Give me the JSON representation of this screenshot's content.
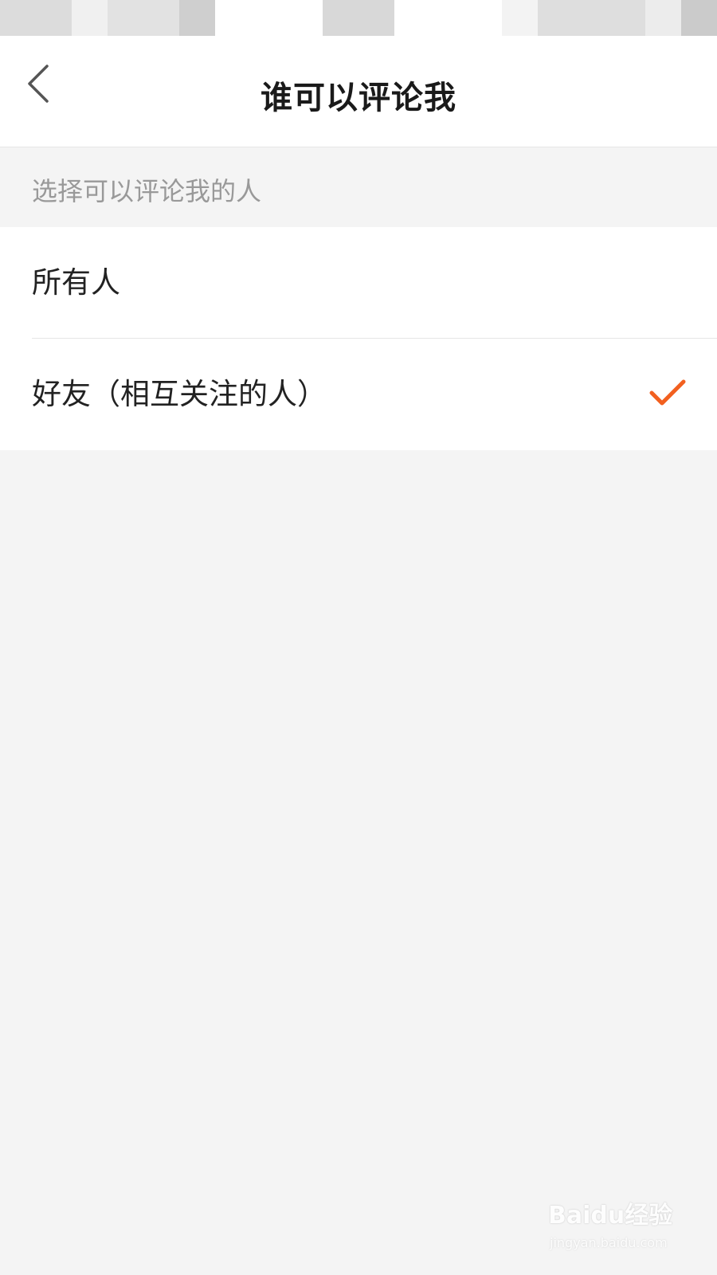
{
  "nav": {
    "title": "谁可以评论我"
  },
  "section": {
    "header": "选择可以评论我的人"
  },
  "options": [
    {
      "label": "所有人",
      "selected": false
    },
    {
      "label": "好友（相互关注的人）",
      "selected": true
    }
  ],
  "colors": {
    "accent": "#f2601f",
    "page_bg": "#f4f4f4",
    "card_bg": "#ffffff",
    "hint_text": "#999999"
  },
  "icons": {
    "back": "chevron-left-icon",
    "selected": "check-icon"
  },
  "watermark": {
    "main": "Baidu经验",
    "sub": "jingyan.baidu.com"
  }
}
